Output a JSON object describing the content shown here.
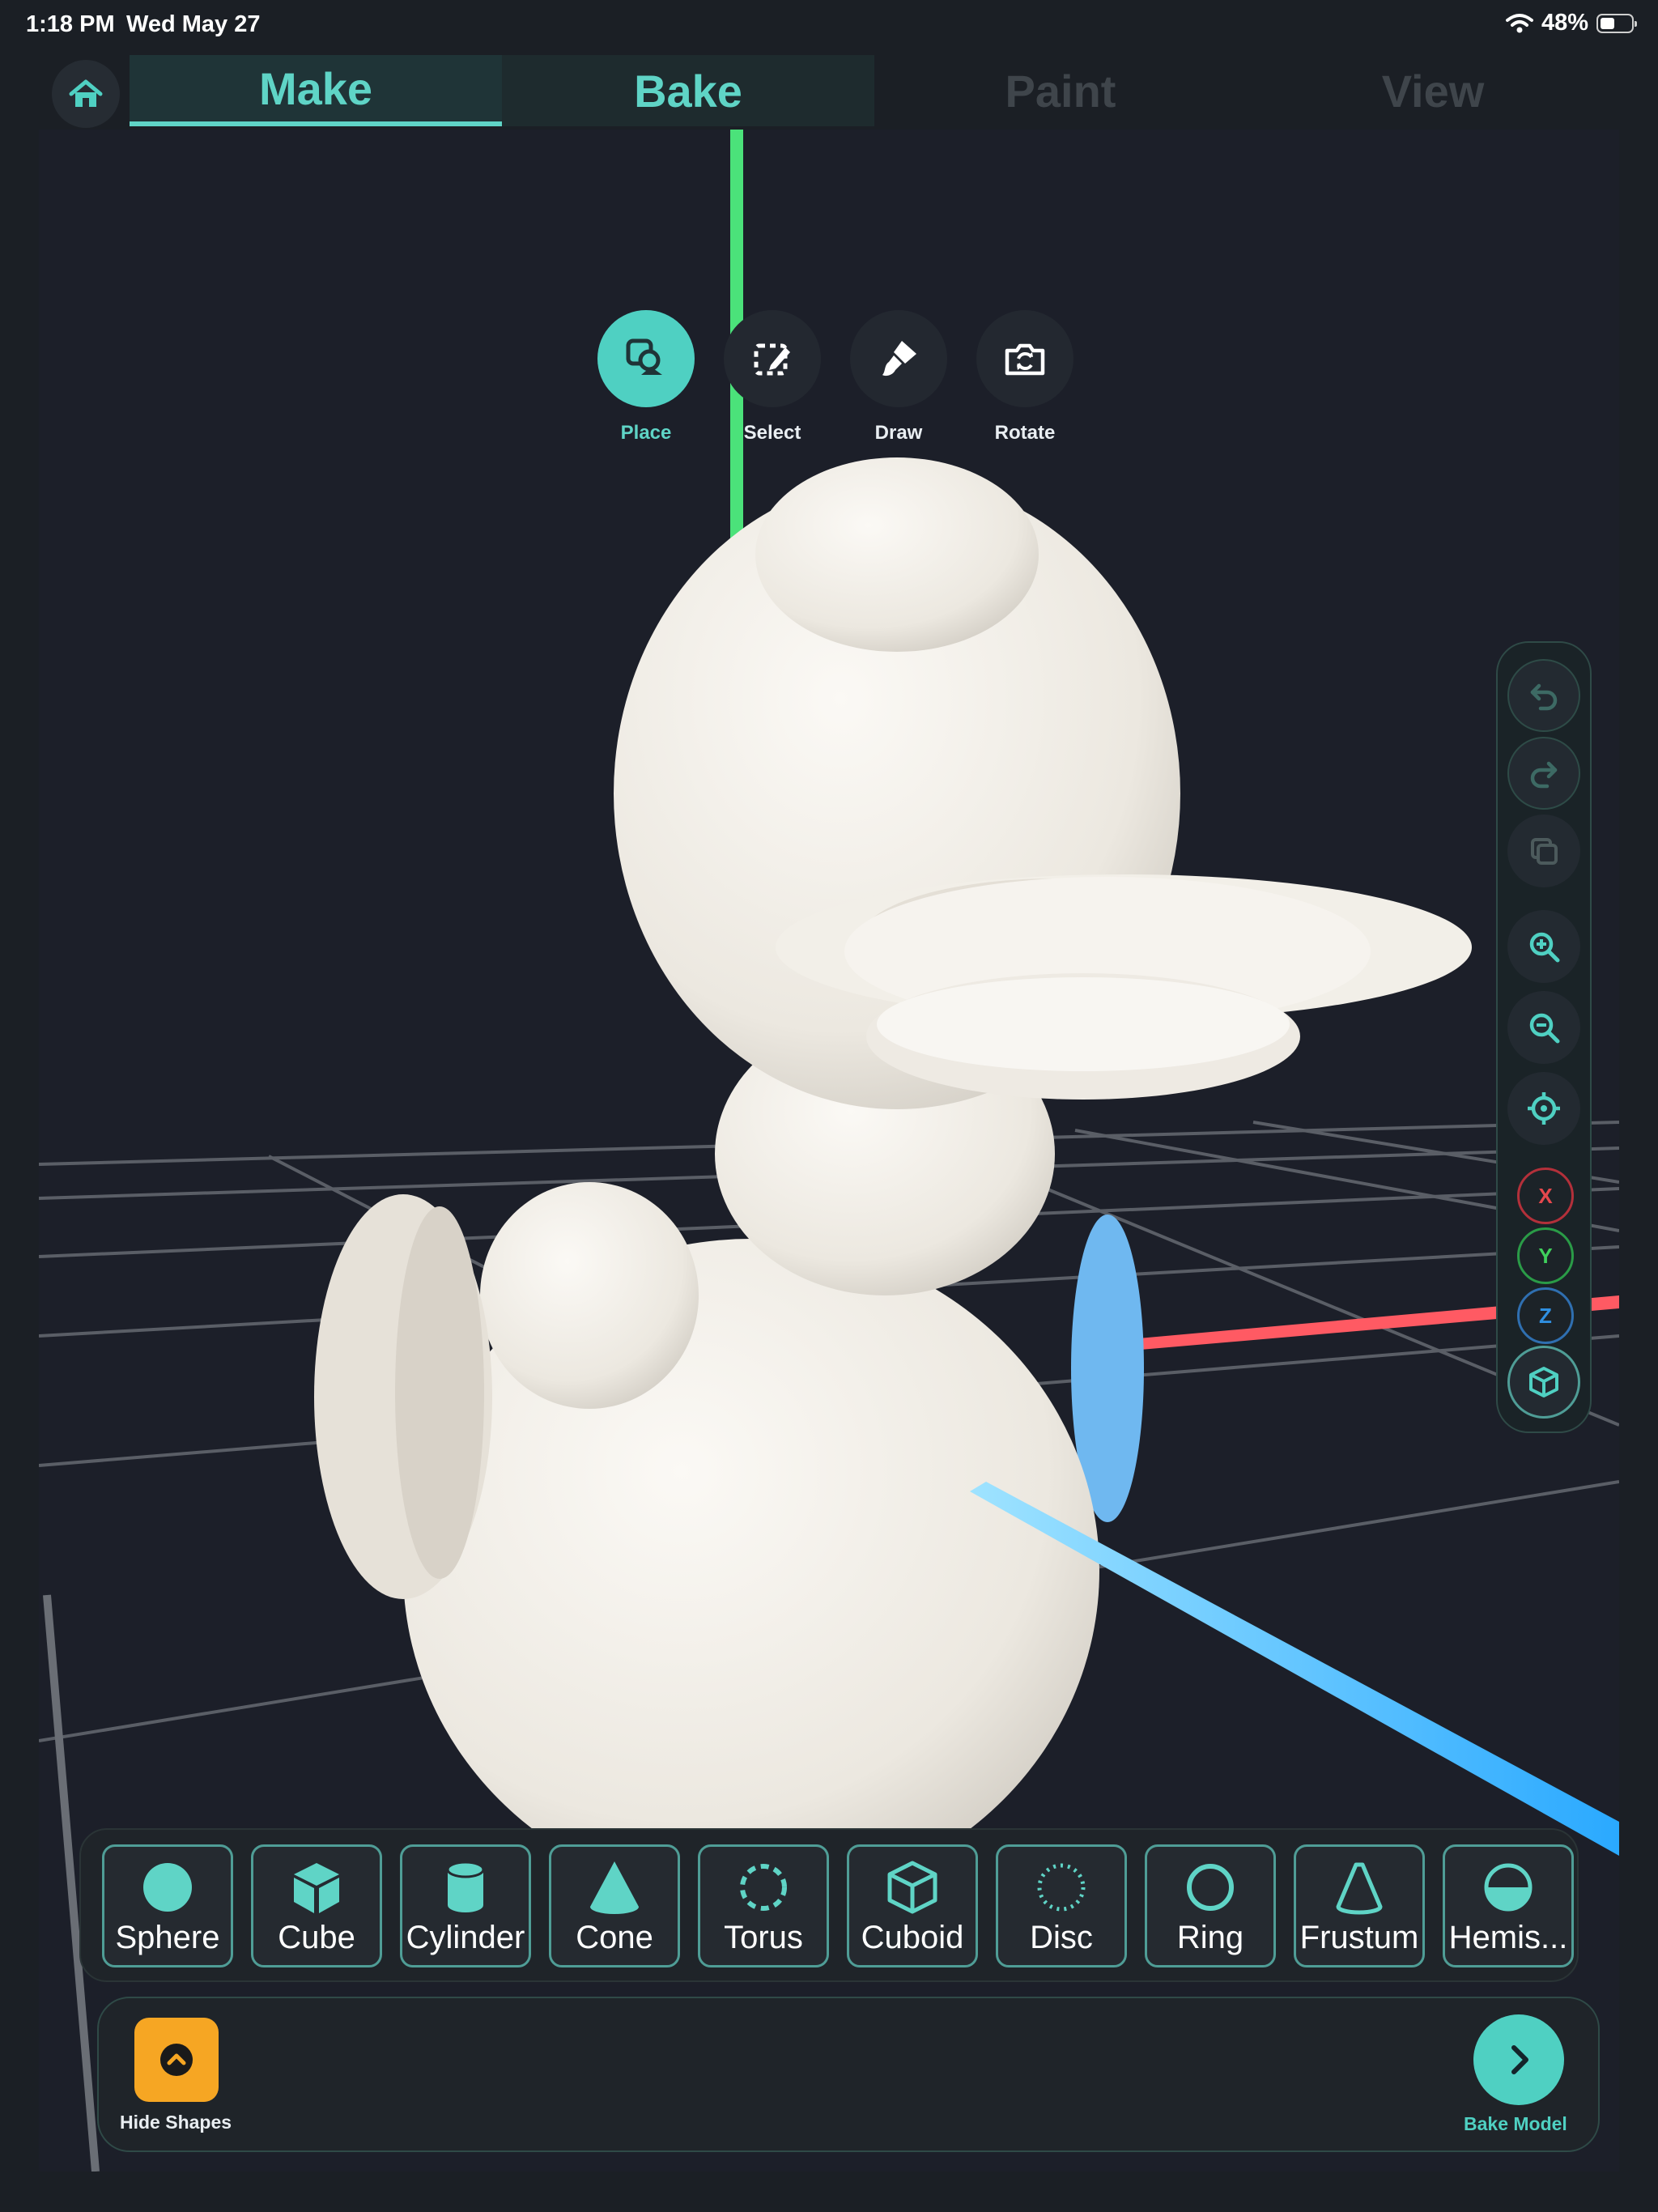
{
  "status_bar": {
    "time": "1:18 PM",
    "date": "Wed May 27",
    "battery": "48%",
    "battery_level": 0.48
  },
  "tabs": [
    {
      "label": "Make",
      "state": "active"
    },
    {
      "label": "Bake",
      "state": "enabled"
    },
    {
      "label": "Paint",
      "state": "disabled"
    },
    {
      "label": "View",
      "state": "disabled"
    }
  ],
  "tools": [
    {
      "label": "Place",
      "icon": "place-shapes-icon",
      "active": true
    },
    {
      "label": "Select",
      "icon": "select-icon",
      "active": false
    },
    {
      "label": "Draw",
      "icon": "paintbrush-icon",
      "active": false
    },
    {
      "label": "Rotate",
      "icon": "rotate-camera-icon",
      "active": false
    }
  ],
  "side_panel": {
    "buttons": [
      "undo-icon",
      "redo-icon",
      "duplicate-icon",
      "zoom-in-icon",
      "zoom-out-icon",
      "recenter-icon"
    ],
    "axes": [
      {
        "label": "X",
        "color": "#e5484d"
      },
      {
        "label": "Y",
        "color": "#3fcf5c"
      },
      {
        "label": "Z",
        "color": "#2f8fe0"
      }
    ],
    "view_cube": "cube-view-icon"
  },
  "shapes": [
    {
      "label": "Sphere",
      "icon": "sphere-icon"
    },
    {
      "label": "Cube",
      "icon": "cube-icon"
    },
    {
      "label": "Cylinder",
      "icon": "cylinder-icon"
    },
    {
      "label": "Cone",
      "icon": "cone-icon"
    },
    {
      "label": "Torus",
      "icon": "torus-icon"
    },
    {
      "label": "Cuboid",
      "icon": "cuboid-icon"
    },
    {
      "label": "Disc",
      "icon": "disc-icon"
    },
    {
      "label": "Ring",
      "icon": "ring-icon"
    },
    {
      "label": "Frustum",
      "icon": "frustum-icon"
    },
    {
      "label": "Hemis...",
      "icon": "hemisphere-icon"
    }
  ],
  "bottom_bar": {
    "hide_label": "Hide Shapes",
    "bake_label": "Bake Model"
  },
  "colors": {
    "accent": "#4fd0c2",
    "warning": "#f6a623",
    "x_axis": "#ff5a63",
    "y_axis": "#4be27a",
    "z_axis": "#3fb8ff"
  }
}
